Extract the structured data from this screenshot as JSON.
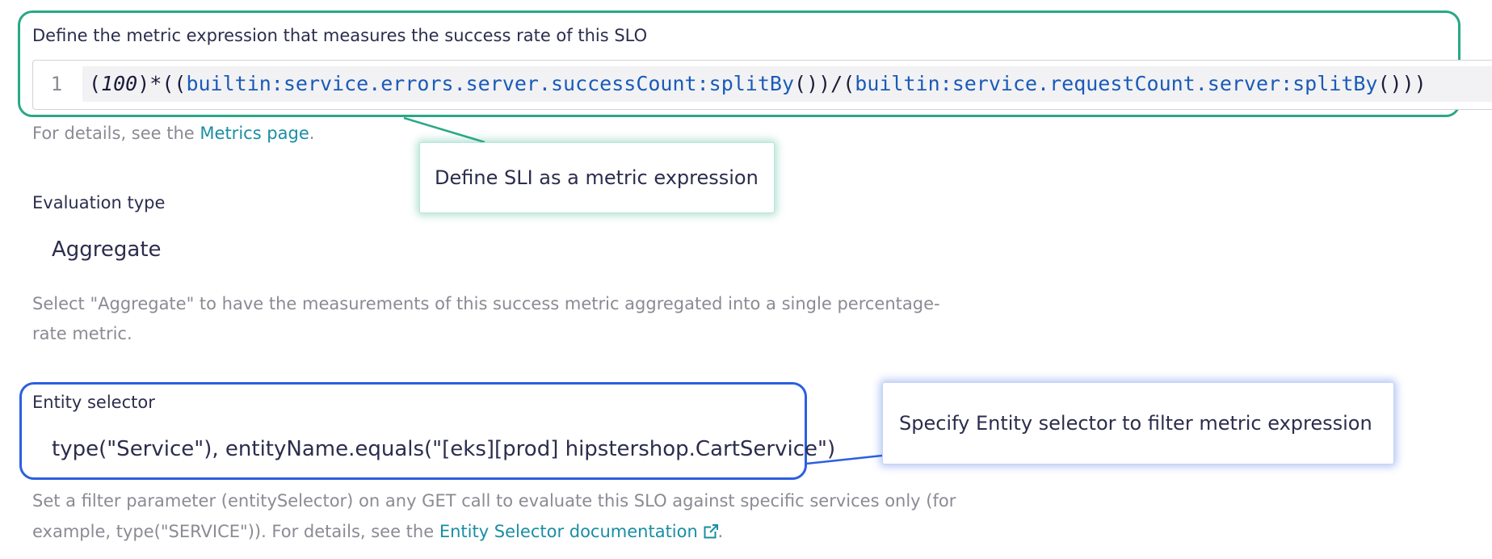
{
  "metric_expression": {
    "label": "Define the metric expression that measures the success rate of this SLO",
    "line_number": "1",
    "code_tokens": [
      {
        "text": "(",
        "kind": "punct"
      },
      {
        "text": "100",
        "kind": "num"
      },
      {
        "text": ")*((",
        "kind": "punct"
      },
      {
        "text": "builtin:service.errors.server.successCount:splitBy",
        "kind": "metric"
      },
      {
        "text": "())/(",
        "kind": "punct"
      },
      {
        "text": "builtin:service.requestCount.server:splitBy",
        "kind": "metric"
      },
      {
        "text": "()))",
        "kind": "punct"
      }
    ],
    "help_prefix": "For details, see the ",
    "help_link": "Metrics page",
    "help_suffix": "."
  },
  "callouts": {
    "sli": "Define SLI as a metric expression",
    "entity": "Specify Entity selector to filter metric expression"
  },
  "evaluation": {
    "label": "Evaluation type",
    "value": "Aggregate",
    "help_line1": "Select \"Aggregate\" to have the measurements of this success metric aggregated into a single percentage-",
    "help_line2": "rate metric."
  },
  "entity_selector": {
    "label": "Entity selector",
    "value": "type(\"Service\"), entityName.equals(\"[eks][prod] hipstershop.CartService\")",
    "help_line1": "Set a filter parameter (entitySelector) on any GET call to evaluate this SLO against specific services only (for",
    "help_line2_prefix": "example, type(\"SERVICE\")). For details, see the ",
    "help_link": "Entity Selector documentation",
    "help_link_icon": "external-link-icon",
    "help_suffix": "."
  },
  "colors": {
    "highlight_green": "#2aa886",
    "highlight_blue": "#2c5fe0",
    "link": "#1a8ea3",
    "metric_token": "#1a5bb8"
  }
}
